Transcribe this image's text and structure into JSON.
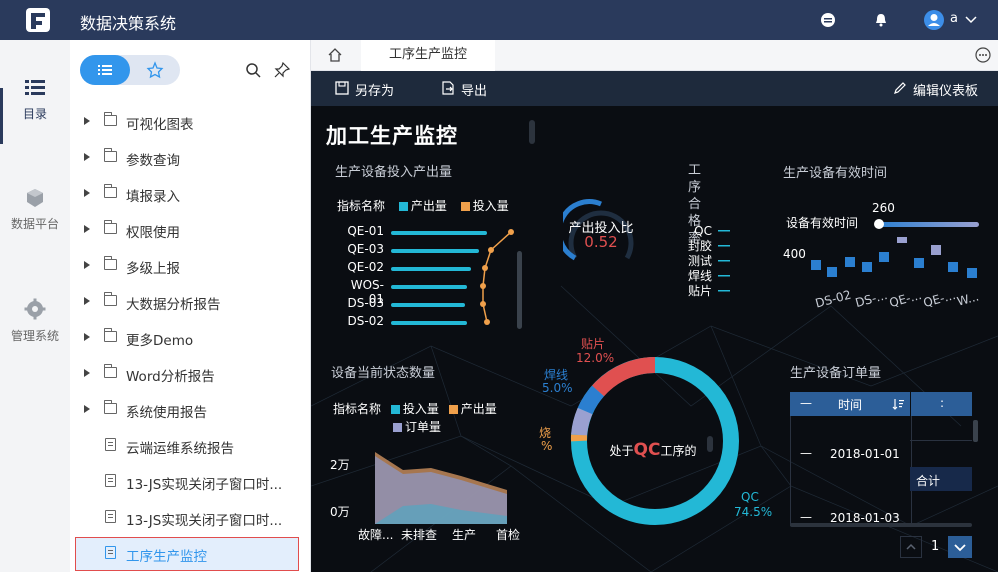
{
  "app": {
    "title": "数据决策系统",
    "user": "a"
  },
  "leftnav": {
    "items": [
      {
        "label": "目录"
      },
      {
        "label": "数据平台"
      },
      {
        "label": "管理系统"
      }
    ]
  },
  "tree": {
    "items": [
      {
        "label": "可视化图表",
        "type": "folder"
      },
      {
        "label": "参数查询",
        "type": "folder"
      },
      {
        "label": "填报录入",
        "type": "folder"
      },
      {
        "label": "权限使用",
        "type": "folder"
      },
      {
        "label": "多级上报",
        "type": "folder"
      },
      {
        "label": "大数据分析报告",
        "type": "folder"
      },
      {
        "label": "更多Demo",
        "type": "folder"
      },
      {
        "label": "Word分析报告",
        "type": "folder"
      },
      {
        "label": "系统使用报告",
        "type": "folder"
      },
      {
        "label": "云端运维系统报告",
        "type": "doc"
      },
      {
        "label": "13-JS实现关闭子窗口时...",
        "type": "doc"
      },
      {
        "label": "13-JS实现关闭子窗口时...",
        "type": "doc"
      },
      {
        "label": "工序生产监控",
        "type": "doc",
        "selected": true
      }
    ]
  },
  "tabs": {
    "active": "工序生产监控"
  },
  "toolbar": {
    "save_as": "另存为",
    "export": "导出",
    "edit": "编辑仪表板"
  },
  "dashboard": {
    "title": "加工生产监控",
    "panel1": {
      "title": "生产设备投入产出量",
      "legend_name": "指标名称",
      "legend_output": "产出量",
      "legend_input": "投入量",
      "rows": [
        "QE-01",
        "QE-03",
        "QE-02",
        "WOS-01",
        "DS-03",
        "DS-02"
      ]
    },
    "gauge": {
      "label": "产出投入比",
      "value": "0.52"
    },
    "panel2": {
      "title": "工序合格率",
      "rows": [
        "QC",
        "封胶",
        "测试",
        "焊线",
        "贴片"
      ]
    },
    "panel3": {
      "title": "生产设备有效时间",
      "axis_label": "设备有效时间",
      "v_top": "260",
      "v_left": "400",
      "x_labels": [
        "DS-02",
        "DS-...",
        "QE-...",
        "QE-...",
        "W..."
      ]
    },
    "panel4": {
      "title": "设备当前状态数量",
      "legend_name": "指标名称",
      "legend_input": "投入量",
      "legend_output": "产出量",
      "legend_order": "订单量",
      "y_top": "2万",
      "y_bottom": "0万",
      "x_labels": [
        "故障...",
        "未排查",
        "生产",
        "首检"
      ]
    },
    "donut": {
      "center_prefix": "处于",
      "center_code": "QC",
      "center_suffix": "工序的",
      "labels": [
        {
          "name": "贴片",
          "pct": "12.0%"
        },
        {
          "name": "焊线",
          "pct": "5.0%"
        },
        {
          "name": "烧",
          "pct": "%"
        },
        {
          "name": "QC",
          "pct": "74.5%"
        }
      ]
    },
    "panel5": {
      "title": "生产设备订单量",
      "col_time": "时间",
      "col_second": ":",
      "rows": [
        "2018-01-01",
        "2018-01-03"
      ],
      "total": "合计",
      "dash": "—",
      "page": "1"
    }
  },
  "colors": {
    "topbar": "#2a3a5c",
    "accent": "#3296ec",
    "cyan": "#23b8d6",
    "orange": "#f0a04b",
    "red": "#e05050",
    "blue": "#2b7fd0",
    "lavender": "#9aa0d0"
  }
}
